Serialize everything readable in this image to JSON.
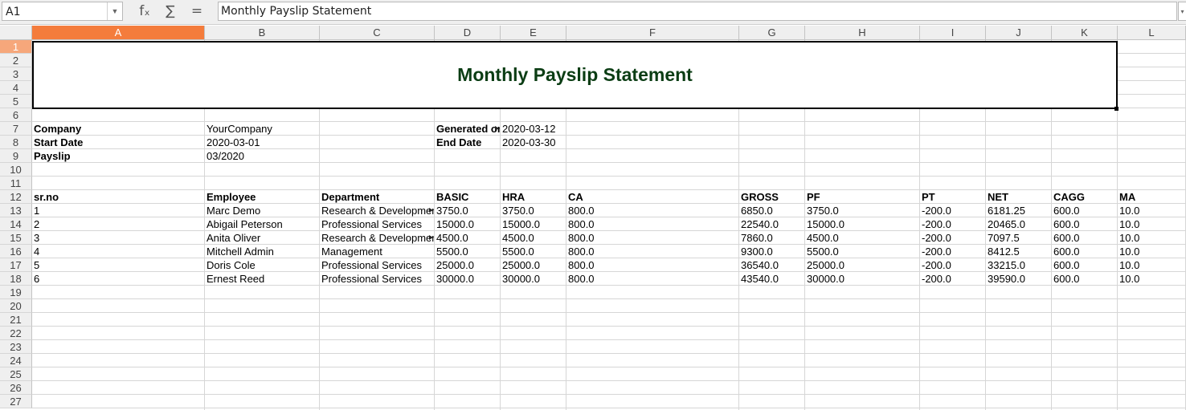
{
  "formula_bar": {
    "cell_ref": "A1",
    "fx_symbol": "fₓ",
    "sum_symbol": "∑",
    "equals_symbol": "=",
    "formula": "Monthly Payslip Statement"
  },
  "columns": [
    "A",
    "B",
    "C",
    "D",
    "E",
    "F",
    "G",
    "H",
    "I",
    "J",
    "K",
    "L"
  ],
  "rows": [
    "1",
    "2",
    "3",
    "4",
    "5",
    "6",
    "7",
    "8",
    "9",
    "10",
    "11",
    "12",
    "13",
    "14",
    "15",
    "16",
    "17",
    "18",
    "19",
    "20",
    "21",
    "22",
    "23",
    "24",
    "25",
    "26",
    "27"
  ],
  "title": "Monthly Payslip Statement",
  "info": {
    "company_label": "Company",
    "company_value": "YourCompany",
    "generated_label": "Generated on",
    "generated_value": "2020-03-12",
    "start_label": "Start Date",
    "start_value": "2020-03-01",
    "end_label": "End Date",
    "end_value": "2020-03-30",
    "payslip_label": "Payslip",
    "payslip_value": "03/2020"
  },
  "table": {
    "headers": [
      "sr.no",
      "Employee",
      "Department",
      "BASIC",
      "HRA",
      "CA",
      "GROSS",
      "PF",
      "PT",
      "NET",
      "CAGG",
      "MA"
    ],
    "rows": [
      [
        "1",
        "Marc Demo",
        "Research & Development",
        "3750.0",
        "3750.0",
        "800.0",
        "6850.0",
        "3750.0",
        "-200.0",
        "6181.25",
        "600.0",
        "10.0"
      ],
      [
        "2",
        "Abigail Peterson",
        "Professional Services",
        "15000.0",
        "15000.0",
        "800.0",
        "22540.0",
        "15000.0",
        "-200.0",
        "20465.0",
        "600.0",
        "10.0"
      ],
      [
        "3",
        "Anita Oliver",
        "Research & Development",
        "4500.0",
        "4500.0",
        "800.0",
        "7860.0",
        "4500.0",
        "-200.0",
        "7097.5",
        "600.0",
        "10.0"
      ],
      [
        "4",
        "Mitchell Admin",
        "Management",
        "5500.0",
        "5500.0",
        "800.0",
        "9300.0",
        "5500.0",
        "-200.0",
        "8412.5",
        "600.0",
        "10.0"
      ],
      [
        "5",
        "Doris Cole",
        "Professional Services",
        "25000.0",
        "25000.0",
        "800.0",
        "36540.0",
        "25000.0",
        "-200.0",
        "33215.0",
        "600.0",
        "10.0"
      ],
      [
        "6",
        "Ernest Reed",
        "Professional Services",
        "30000.0",
        "30000.0",
        "800.0",
        "43540.0",
        "30000.0",
        "-200.0",
        "39590.0",
        "600.0",
        "10.0"
      ]
    ]
  },
  "colors": {
    "selected_header": "#f47c3c",
    "selected_row_header": "#f6a77b",
    "title_text": "#0b3d14"
  }
}
